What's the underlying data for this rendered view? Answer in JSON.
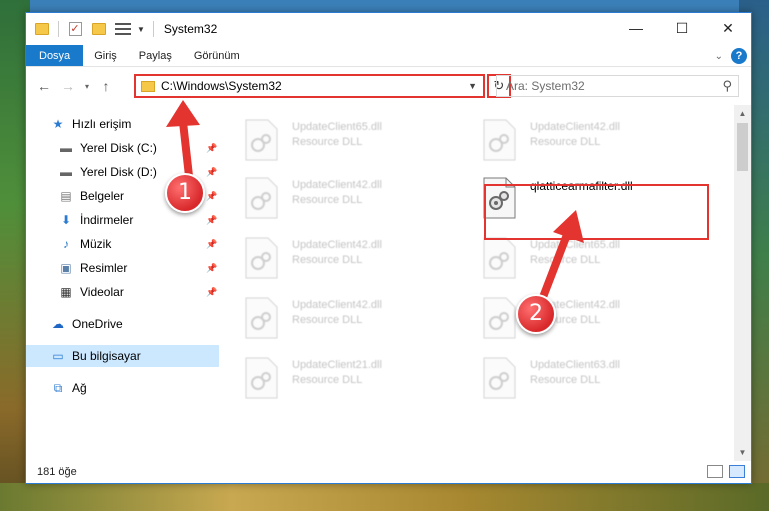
{
  "window": {
    "title": "System32"
  },
  "ribbon": {
    "tabs": [
      "Dosya",
      "Giriş",
      "Paylaş",
      "Görünüm"
    ]
  },
  "address": {
    "path": "C:\\Windows\\System32"
  },
  "search": {
    "placeholder": "Ara: System32"
  },
  "nav_pane": {
    "items": [
      {
        "label": "Hızlı erişim",
        "icon": "star-icon",
        "pinned": false
      },
      {
        "label": "Yerel Disk (C:)",
        "icon": "drive-icon",
        "pinned": true
      },
      {
        "label": "Yerel Disk (D:)",
        "icon": "drive-icon",
        "pinned": true
      },
      {
        "label": "Belgeler",
        "icon": "documents-icon",
        "pinned": true
      },
      {
        "label": "İndirmeler",
        "icon": "download-icon",
        "pinned": true
      },
      {
        "label": "Müzik",
        "icon": "music-icon",
        "pinned": true
      },
      {
        "label": "Resimler",
        "icon": "pictures-icon",
        "pinned": true
      },
      {
        "label": "Videolar",
        "icon": "videos-icon",
        "pinned": true
      },
      {
        "label": "OneDrive",
        "icon": "cloud-icon",
        "pinned": false
      },
      {
        "label": "Bu bilgisayar",
        "icon": "computer-icon",
        "pinned": false,
        "selected": true
      },
      {
        "label": "Ağ",
        "icon": "network-icon",
        "pinned": false
      }
    ]
  },
  "files": [
    {
      "name": "UpdateClient65.dll",
      "type": "Resource DLL",
      "faded": true
    },
    {
      "name": "UpdateClient42.dll",
      "type": "Resource DLL",
      "faded": true
    },
    {
      "name": "UpdateClient42.dll",
      "type": "Resource DLL",
      "faded": true
    },
    {
      "name": "qlatticearmafilter.dll",
      "type": "",
      "faded": false
    },
    {
      "name": "UpdateClient42.dll",
      "type": "Resource DLL",
      "faded": true
    },
    {
      "name": "UpdateClient65.dll",
      "type": "Resource DLL",
      "faded": true
    },
    {
      "name": "UpdateClient42.dll",
      "type": "Resource DLL",
      "faded": true
    },
    {
      "name": "UpdateClient42.dll",
      "type": "Resource DLL",
      "faded": true
    },
    {
      "name": "UpdateClient21.dll",
      "type": "Resource DLL",
      "faded": true
    },
    {
      "name": "UpdateClient63.dll",
      "type": "Resource DLL",
      "faded": true
    }
  ],
  "status": {
    "count": "181 öğe"
  },
  "annotations": {
    "step1": "1",
    "step2": "2",
    "color": "#e3342f"
  }
}
